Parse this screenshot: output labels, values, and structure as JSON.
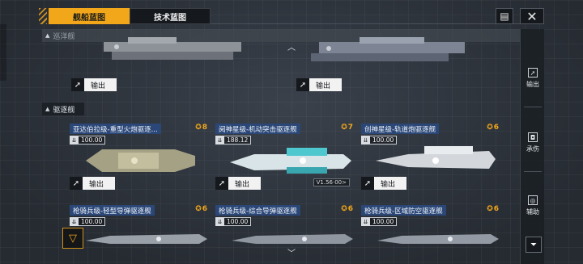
{
  "tabs": {
    "active": "舰船蓝图",
    "inactive": "技术蓝图"
  },
  "toolbar": {
    "doc_icon": "▤",
    "close_icon": "✕"
  },
  "sections": {
    "cruiser": "巡洋舰",
    "destroyer": "驱逐舰"
  },
  "export_label": "输出",
  "rail": {
    "export": "输出",
    "tank": "承伤",
    "support": "辅助"
  },
  "cards": [
    {
      "title": "亚达伯拉级-重型火炮驱逐...",
      "rank": "8",
      "stat": "100.00",
      "colors": {
        "accent": "#b8b49a"
      }
    },
    {
      "title": "阋神星级-机动突击驱逐舰",
      "rank": "7",
      "stat": "188.12",
      "tag": "V1.56·00>",
      "colors": {
        "accent": "#4fc7cf"
      }
    },
    {
      "title": "创神星级-轨道炮驱逐舰",
      "rank": "6",
      "stat": "100.00",
      "colors": {
        "accent": "#d9dde2"
      }
    },
    {
      "title": "枪骑兵级-轻型导弹驱逐舰",
      "rank": "6",
      "stat": "100.00"
    },
    {
      "title": "枪骑兵级-综合导弹驱逐舰",
      "rank": "6",
      "stat": "100.00"
    },
    {
      "title": "枪骑兵级-区域防空驱逐舰",
      "rank": "6",
      "stat": "100.00"
    }
  ]
}
